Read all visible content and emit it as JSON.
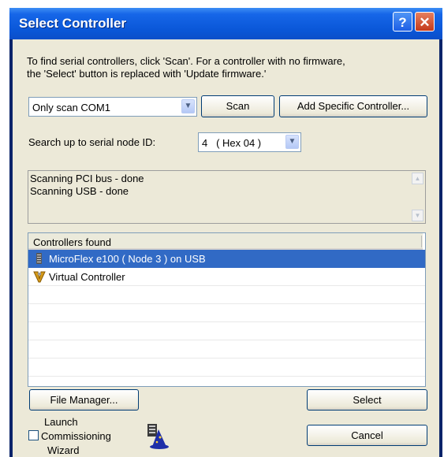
{
  "window": {
    "title": "Select Controller",
    "help": "?",
    "close": "✕"
  },
  "instructions": {
    "line1": "To find serial controllers, click 'Scan'.  For a controller with no firmware,",
    "line2": "the 'Select' button is replaced with 'Update firmware.'"
  },
  "scan_combo": {
    "value": "Only scan COM1"
  },
  "buttons": {
    "scan": "Scan",
    "add_specific": "Add Specific Controller...",
    "file_manager": "File Manager...",
    "select": "Select",
    "cancel": "Cancel"
  },
  "node_search": {
    "label": "Search up to serial node ID:",
    "value": "4   ( Hex 04 )"
  },
  "log": {
    "lines": [
      "Scanning PCI bus - done",
      "Scanning USB - done"
    ]
  },
  "controllers": {
    "header": "Controllers found",
    "items": [
      {
        "label": "MicroFlex e100 ( Node 3 ) on USB",
        "icon": "drive-icon",
        "selected": true
      },
      {
        "label": "Virtual Controller",
        "icon": "virtual-controller-icon",
        "selected": false
      }
    ]
  },
  "commissioning": {
    "line1": "Launch",
    "line2": "Commissioning",
    "line3": "Wizard",
    "checked": false,
    "icon": "wizard-icon"
  }
}
